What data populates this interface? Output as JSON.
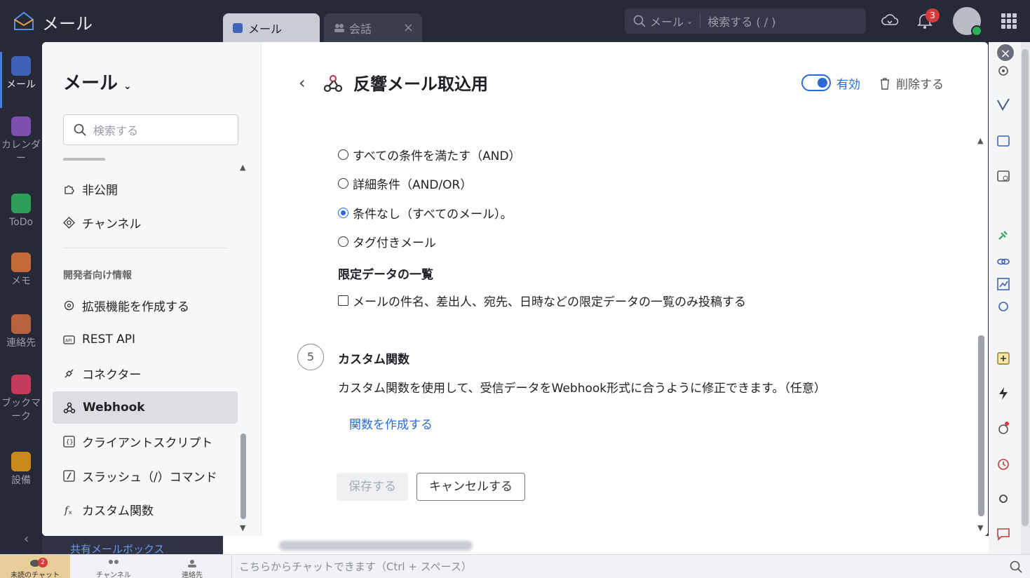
{
  "app": {
    "title": "メール"
  },
  "tabs": [
    {
      "label": "メール",
      "icon": "mail-icon"
    },
    {
      "label": "会話",
      "icon": "people-icon"
    }
  ],
  "search": {
    "scope": "メール",
    "placeholder": "検索する ( / )"
  },
  "notifications": {
    "count": "3"
  },
  "rail": [
    {
      "label": "メール",
      "color": "#3c63b6"
    },
    {
      "label": "カレンダー",
      "color": "#7b4fb0"
    },
    {
      "label": "ToDo",
      "color": "#2f9e5a"
    },
    {
      "label": "メモ",
      "color": "#c26a3a"
    },
    {
      "label": "連絡先",
      "color": "#b8623e"
    },
    {
      "label": "ブックマーク",
      "color": "#c33a5a"
    },
    {
      "label": "設備",
      "color": "#c98a1a"
    }
  ],
  "sidebar": {
    "title": "メール",
    "search_placeholder": "検索する",
    "items_top": [
      {
        "label": "非公開"
      },
      {
        "label": "チャンネル"
      }
    ],
    "section": "開発者向け情報",
    "items_dev": [
      {
        "label": "拡張機能を作成する"
      },
      {
        "label": "REST API"
      },
      {
        "label": "コネクター"
      },
      {
        "label": "Webhook"
      },
      {
        "label": "クライアントスクリプト"
      },
      {
        "label": "スラッシュ（/）コマンド"
      },
      {
        "label": "カスタム関数"
      }
    ]
  },
  "main": {
    "title": "反響メール取込用",
    "toggle_label": "有効",
    "toggle_on": true,
    "delete_label": "削除する",
    "conditions": [
      {
        "label": "すべての条件を満たす（AND）",
        "selected": false
      },
      {
        "label": "詳細条件（AND/OR）",
        "selected": false
      },
      {
        "label": "条件なし（すべてのメール）。",
        "selected": true
      },
      {
        "label": "タグ付きメール",
        "selected": false
      }
    ],
    "limited_heading": "限定データの一覧",
    "limited_checkbox": "メールの件名、差出人、宛先、日時などの限定データの一覧のみ投稿する",
    "step_number": "5",
    "step_title": "カスタム関数",
    "step_desc": "カスタム関数を使用して、受信データをWebhook形式に合うように修正できます。（任意）",
    "create_link": "関数を作成する",
    "save_label": "保存する",
    "cancel_label": "キャンセルする"
  },
  "behind": {
    "shared_mailbox": "共有メールボックス"
  },
  "bottom": {
    "unread_chat": "未読のチャット",
    "unread_count": "2",
    "channels": "チャンネル",
    "contacts": "連絡先",
    "chat_placeholder": "こちらからチャットできます（Ctrl + スペース）"
  },
  "colors": {
    "accent": "#2b6ad6",
    "topbar": "#262936"
  }
}
